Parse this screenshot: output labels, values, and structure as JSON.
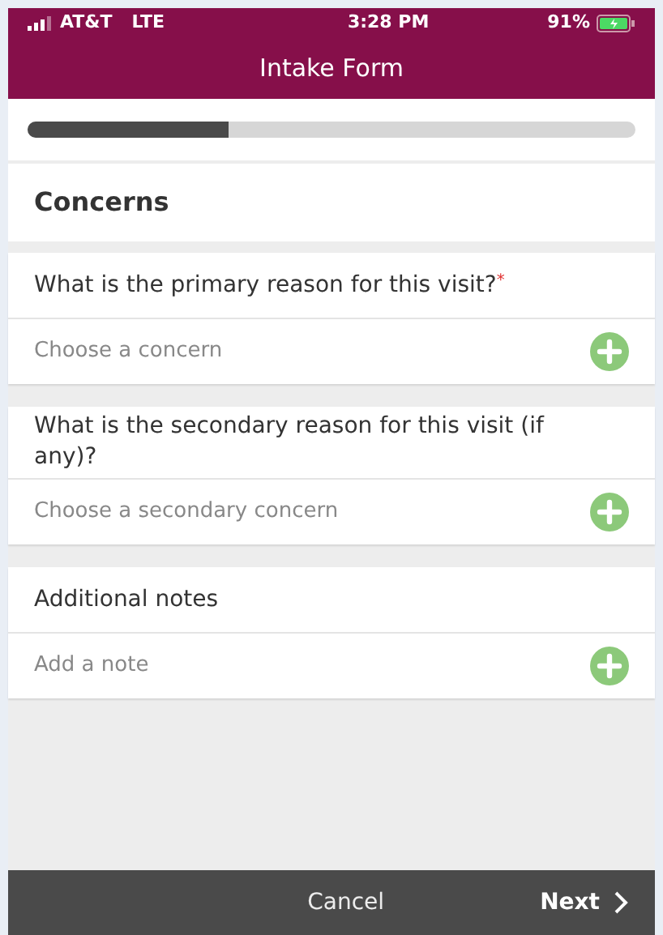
{
  "status_bar": {
    "carrier": "AT&T",
    "network": "LTE",
    "time": "3:28 PM",
    "battery": "91%"
  },
  "header": {
    "title": "Intake Form"
  },
  "progress": {
    "level": 0.33
  },
  "section_title": "Concerns",
  "questions": [
    {
      "question": "What is the primary reason for this visit?",
      "required_mark": "*",
      "placeholder": "Choose a concern"
    },
    {
      "question": "What is the secondary reason for this visit (if any)?",
      "placeholder": "Choose a secondary concern"
    },
    {
      "question": "Additional notes",
      "placeholder": "Add a note"
    }
  ],
  "footer": {
    "cancel": "Cancel",
    "next": "Next"
  }
}
